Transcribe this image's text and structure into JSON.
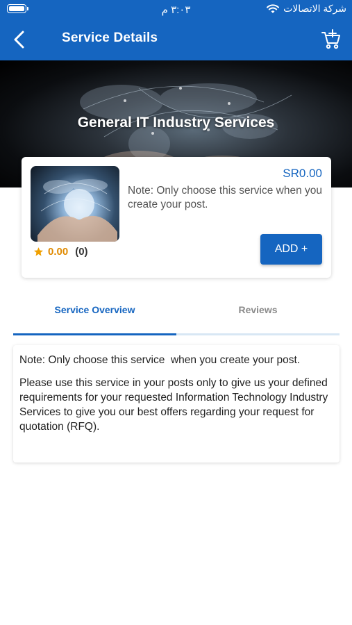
{
  "status_bar": {
    "time": "٣:٠٣ م",
    "carrier": "شركة الاتصالات",
    "icons": [
      "battery-icon",
      "wifi-icon"
    ]
  },
  "nav": {
    "title": "Service Details",
    "back_icon": "chevron-left-icon",
    "cart_icon": "cart-add-icon"
  },
  "hero": {
    "title": "General IT Industry Services"
  },
  "service": {
    "price": "SR0.00",
    "note": "Note: Only choose this service when you create your post.",
    "rating": "0.00",
    "rating_count": "(0)",
    "add_label": "ADD +"
  },
  "tabs": [
    {
      "label": "Service Overview",
      "active": true
    },
    {
      "label": "Reviews",
      "active": false
    }
  ],
  "overview": {
    "note": "Note: Only choose this service  when you create your post.",
    "body": "Please use this service in your posts only to give us your defined requirements for your requested Information Technology Industry Services to give you our best offers regarding your request for quotation (RFQ)."
  },
  "colors": {
    "primary": "#1565c0",
    "star": "#f0a000",
    "muted_tab": "#8a8a8a"
  }
}
